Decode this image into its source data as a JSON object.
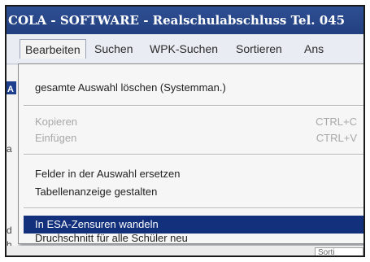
{
  "window": {
    "title": "COLA - SOFTWARE - Realschulabschluss   Tel. 045"
  },
  "menubar": {
    "items": [
      {
        "label": "Bearbeiten"
      },
      {
        "label": "Suchen"
      },
      {
        "label": "WPK-Suchen"
      },
      {
        "label": "Sortieren"
      },
      {
        "label": "Ans"
      }
    ]
  },
  "sidebar": {
    "fragments": [
      "A",
      "a",
      "d",
      "h"
    ]
  },
  "dropdown": {
    "items": [
      {
        "label": "gesamte Auswahl löschen (Systemman.)",
        "shortcut": "",
        "state": "enabled"
      },
      {
        "label": "Kopieren",
        "shortcut": "CTRL+C",
        "state": "disabled"
      },
      {
        "label": "Einfügen",
        "shortcut": "CTRL+V",
        "state": "disabled"
      },
      {
        "label": "Felder in der Auswahl ersetzen",
        "shortcut": "",
        "state": "enabled"
      },
      {
        "label": "Tabellenanzeige gestalten",
        "shortcut": "",
        "state": "enabled"
      },
      {
        "label": "In ESA-Zensuren wandeln",
        "shortcut": "",
        "state": "highlighted"
      },
      {
        "label": "Druchschnitt für alle Schüler neu",
        "shortcut": "",
        "state": "enabled"
      }
    ]
  },
  "footer": {
    "field_text": "Sorti"
  },
  "colors": {
    "titlebar": "#22407f",
    "highlight": "#12307c",
    "menu_bg": "#f6f6f6"
  }
}
